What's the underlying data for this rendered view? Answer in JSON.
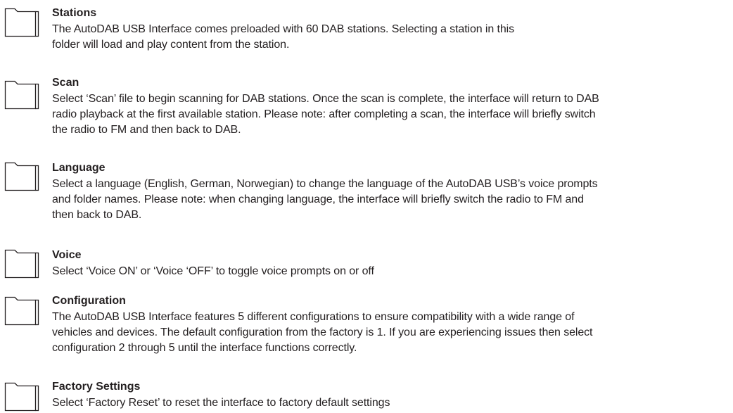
{
  "sections": [
    {
      "title": "Stations",
      "lines": [
        "The AutoDAB USB Interface comes preloaded with 60 DAB stations. Selecting a station in this",
        "folder will load and play content from the station."
      ]
    },
    {
      "title": "Scan",
      "lines": [
        "Select ‘Scan’ file to begin scanning for DAB stations. Once the scan is complete, the interface will return to DAB",
        "radio playback at the first available station. Please note: after completing a scan, the interface will briefly switch",
        "the radio to FM and then back to DAB."
      ]
    },
    {
      "title": "Language",
      "lines": [
        "Select a language (English, German, Norwegian) to change the language of the AutoDAB USB’s voice prompts",
        "and folder names. Please note: when changing language, the interface will briefly switch the radio to FM and",
        "then back to DAB."
      ]
    },
    {
      "title": "Voice",
      "lines": [
        "Select ‘Voice ON’ or ‘Voice ‘OFF’ to toggle voice prompts on or off"
      ]
    },
    {
      "title": "Configuration",
      "lines": [
        "The AutoDAB USB Interface features 5 different configurations to ensure compatibility with a wide range of",
        "vehicles and devices. The default configuration from the factory is 1. If you are experiencing issues then select",
        "configuration 2 through 5 until the interface functions correctly."
      ]
    },
    {
      "title": "Factory Settings",
      "lines": [
        "Select ‘Factory Reset’ to reset the interface to factory default settings"
      ]
    }
  ],
  "icons": {
    "folder": "folder-icon"
  },
  "colors": {
    "text": "#231f20",
    "icon_stroke": "#231f20"
  }
}
